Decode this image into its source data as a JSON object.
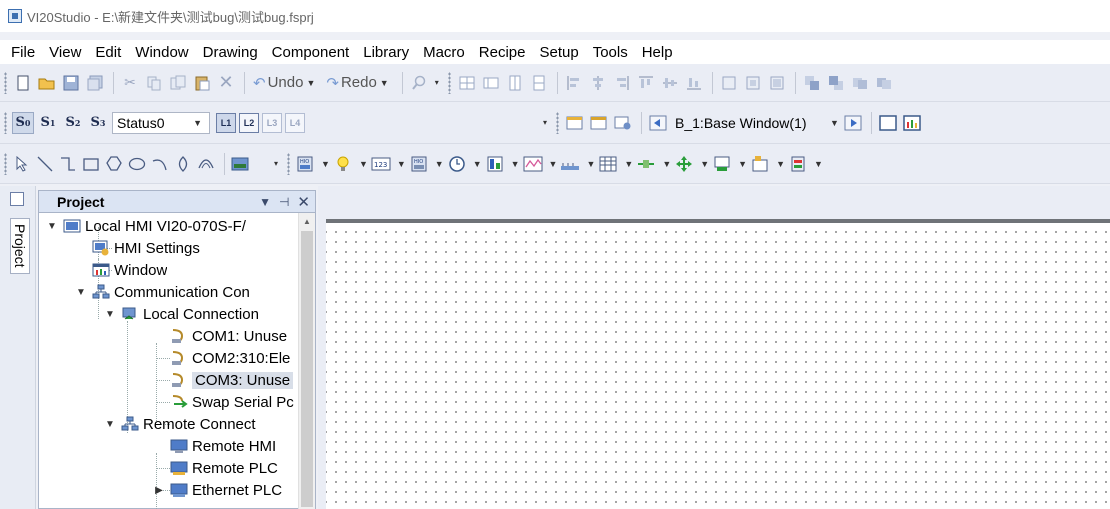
{
  "window": {
    "title": "VI20Studio - E:\\新建文件夹\\测试bug\\测试bug.fsprj"
  },
  "menu": [
    "File",
    "View",
    "Edit",
    "Window",
    "Drawing",
    "Component",
    "Library",
    "Macro",
    "Recipe",
    "Setup",
    "Tools",
    "Help"
  ],
  "toolbar1": {
    "undo_label": "Undo",
    "redo_label": "Redo"
  },
  "toolbar2": {
    "state_buttons": [
      "S0",
      "S1",
      "S2",
      "S3"
    ],
    "status_combo": "Status0",
    "layer_buttons": [
      "L1",
      "L2",
      "L3",
      "L4"
    ],
    "window_combo": "B_1:Base Window(1)"
  },
  "project_tab_label": "Project",
  "panel": {
    "title": "Project",
    "tree": [
      "Local HMI VI20-070S-F/",
      "HMI Settings",
      "Window",
      "Communication Con",
      "Local Connection",
      "COM1: Unuse",
      "COM2:310:Ele",
      "COM3: Unuse",
      "Swap Serial Pc",
      "Remote Connect",
      "Remote HMI",
      "Remote PLC",
      "Ethernet PLC"
    ]
  },
  "colors": {
    "canvas_bg": "#ffffff",
    "selected_row": "#d8dee8",
    "panel_header": "#dbe4f3",
    "toolbar_bg": "#eaedf5"
  }
}
